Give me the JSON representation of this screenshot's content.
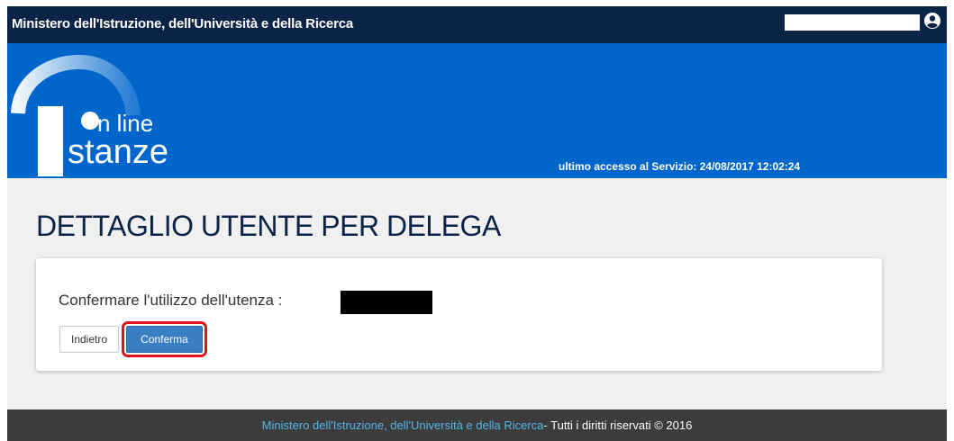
{
  "header": {
    "ministry_title": "Ministero dell'Istruzione, dell'Università e della Ricerca",
    "user_icon": "user-circle-icon"
  },
  "banner": {
    "logo_line1": "n line",
    "logo_line2": "stanze",
    "last_access": "ultimo accesso al Servizio:  24/08/2017 12:02:24"
  },
  "main": {
    "page_title": "DETTAGLIO UTENTE PER DELEGA",
    "confirm_prompt": "Confermare l'utilizzo dell'utenza :",
    "back_button": "Indietro",
    "confirm_button": "Conferma"
  },
  "footer": {
    "link_text": "Ministero dell'Istruzione, dell'Università e della Ricerca",
    "rights_text": " - Tutti i diritti riservati © 2016"
  },
  "colors": {
    "topbar": "#0b2346",
    "banner": "#0066cc",
    "confirm_button": "#3a7fc1",
    "highlight": "#e0121c",
    "footer": "#3c3c3c",
    "footer_link": "#52b6e6"
  }
}
